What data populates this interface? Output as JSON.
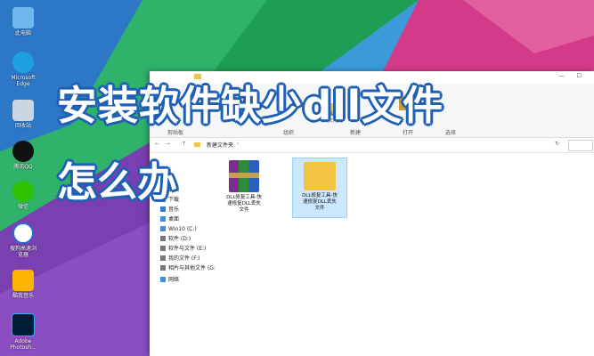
{
  "colors": {
    "accent": "#1f5fb4",
    "folder": "#f2c443",
    "selection": "#cce8ff"
  },
  "headline": {
    "line1": "安装软件缺少dll文件",
    "line2": "怎么办"
  },
  "desktop": {
    "icons": [
      {
        "label": "此电脑",
        "icon": "computer-icon"
      },
      {
        "label": "Microsoft\nEdge",
        "icon": "edge-icon"
      },
      {
        "label": "回收站",
        "icon": "recycle-bin-icon"
      },
      {
        "label": "腾讯QQ",
        "icon": "qq-icon"
      },
      {
        "label": "微信",
        "icon": "wechat-icon"
      },
      {
        "label": "搜狗高速浏\n览器",
        "icon": "sogou-browser-icon"
      },
      {
        "label": "酷我音乐",
        "icon": "kuwo-music-icon"
      },
      {
        "label": "Adobe\nPhotosh...",
        "icon": "photoshop-icon"
      }
    ]
  },
  "explorer": {
    "ribbon": {
      "groups": [
        "剪贴板",
        "组织",
        "新建",
        "打开",
        "选择"
      ],
      "new_folder": "新建\n文件夹"
    },
    "address": {
      "path": "新建文件夹"
    },
    "nav": [
      {
        "label": "文档",
        "icon": "document-icon"
      },
      {
        "label": "下载",
        "icon": "download-icon"
      },
      {
        "label": "音乐",
        "icon": "music-icon"
      },
      {
        "label": "桌面",
        "icon": "desktop-icon"
      },
      {
        "label": "Win10 (C:)",
        "icon": "drive-icon"
      },
      {
        "label": "软件 (D:)",
        "icon": "drive-icon"
      },
      {
        "label": "软件与文件 (E:)",
        "icon": "drive-icon"
      },
      {
        "label": "我的文件 (F:)",
        "icon": "drive-icon"
      },
      {
        "label": "相片与其他文件 (G:",
        "icon": "drive-icon"
      },
      {
        "label": "网络",
        "icon": "network-icon"
      }
    ],
    "files": [
      {
        "name": "DLL修复工具-快\n速修复DLL丢失\n文件",
        "icon": "winrar-archive-icon"
      },
      {
        "name": "DLL修复工具-快\n速修复DLL丢失\n文件",
        "icon": "folder-icon"
      }
    ]
  }
}
